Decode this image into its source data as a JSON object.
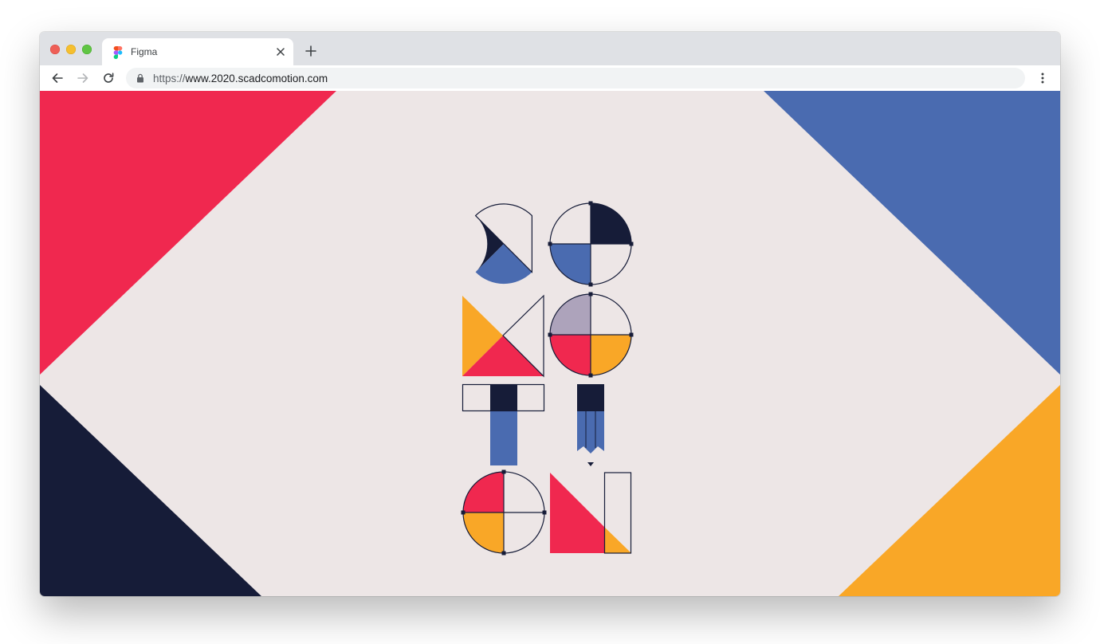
{
  "browser": {
    "tab": {
      "title": "Figma",
      "favicon": "figma-logo-icon",
      "close_icon": "close-icon"
    },
    "new_tab_icon": "plus-icon",
    "nav": {
      "back_icon": "arrow-left-icon",
      "forward_icon": "arrow-right-icon",
      "reload_icon": "reload-icon"
    },
    "address": {
      "scheme": "https://",
      "host": "www.2020.scadcomotion.com",
      "lock_icon": "lock-icon"
    },
    "menu_icon": "kebab-menu-icon"
  },
  "page": {
    "logo_letters": [
      "C",
      "O",
      "M",
      "O",
      "T",
      "I",
      "O",
      "N"
    ],
    "colors": {
      "background": "#ede6e6",
      "red": "#f0284f",
      "blue": "#4a6bb0",
      "navy": "#161c38",
      "yellow": "#f9a727",
      "lavender": "#ada3bb"
    }
  }
}
